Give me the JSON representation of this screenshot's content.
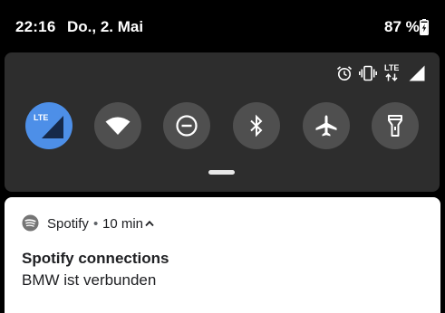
{
  "status_bar": {
    "time": "22:16",
    "date": "Do., 2. Mai",
    "battery_percent": "87 %",
    "battery_icon": "battery-charging-icon"
  },
  "quick_settings": {
    "status_icons": [
      "alarm-icon",
      "vibrate-icon",
      "lte-icon",
      "signal-icon"
    ],
    "lte_label": "LTE",
    "tiles": [
      {
        "name": "mobile-data",
        "icon": "lte-signal-icon",
        "label": "LTE",
        "active": true
      },
      {
        "name": "wifi",
        "icon": "wifi-icon",
        "active": false
      },
      {
        "name": "do-not-disturb",
        "icon": "do-not-disturb-icon",
        "active": false
      },
      {
        "name": "bluetooth",
        "icon": "bluetooth-icon",
        "active": false
      },
      {
        "name": "airplane-mode",
        "icon": "airplane-icon",
        "active": false
      },
      {
        "name": "flashlight",
        "icon": "flashlight-icon",
        "active": false
      }
    ],
    "colors": {
      "panel": "#2d2d2d",
      "tile_inactive": "#4f4f4f",
      "tile_active": "#4d8fe8"
    }
  },
  "notification": {
    "app_name": "Spotify",
    "separator": "•",
    "time": "10 min",
    "title": "Spotify connections",
    "text": "BMW ist verbunden",
    "app_icon": "spotify-icon"
  }
}
